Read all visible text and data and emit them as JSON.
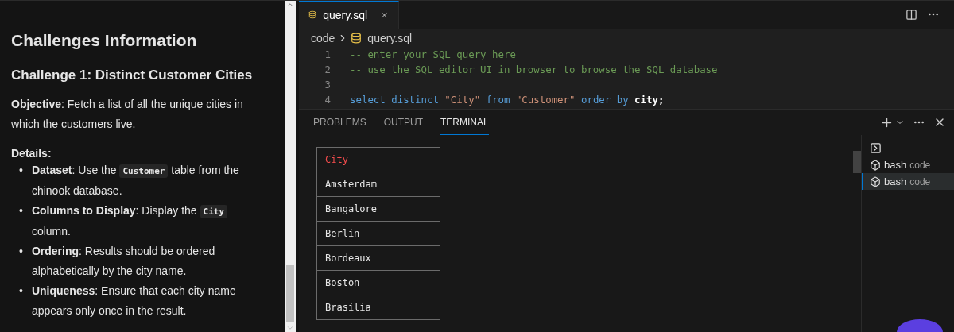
{
  "info": {
    "title": "Challenges Information",
    "challenge": "Challenge 1: Distinct Customer Cities",
    "objective": "**Objective**: Fetch a list of all the unique cities in which the customers live.",
    "details_label": "Details:",
    "details": [
      {
        "marker": "•",
        "segments": [
          {
            "kind": "bold",
            "text": "Dataset"
          },
          {
            "kind": "text",
            "text": ": Use the "
          },
          {
            "kind": "code",
            "text": "Customer"
          },
          {
            "kind": "text",
            "text": " table from the chinook database."
          }
        ]
      },
      {
        "marker": "•",
        "segments": [
          {
            "kind": "bold",
            "text": "Columns to Display"
          },
          {
            "kind": "text",
            "text": ": Display the "
          },
          {
            "kind": "code",
            "text": "City"
          },
          {
            "kind": "text",
            "text": " column."
          }
        ]
      },
      {
        "marker": "•",
        "segments": [
          {
            "kind": "bold",
            "text": "Ordering"
          },
          {
            "kind": "text",
            "text": ": Results should be ordered alphabetically by the city name."
          }
        ]
      },
      {
        "marker": "•",
        "segments": [
          {
            "kind": "bold",
            "text": "Uniqueness"
          },
          {
            "kind": "text",
            "text": ": Ensure that each city name appears only once in the result."
          }
        ]
      }
    ]
  },
  "editor": {
    "tabs": [
      {
        "label": "query.sql",
        "selected": true
      }
    ],
    "breadcrumb": [
      "code",
      "query.sql"
    ],
    "lines": [
      {
        "number": "1",
        "tokens": [
          {
            "kind": "comment",
            "text": "-- enter your SQL query here"
          }
        ]
      },
      {
        "number": "2",
        "tokens": [
          {
            "kind": "comment",
            "text": "-- use the SQL editor UI in browser to browse the SQL database"
          }
        ]
      },
      {
        "number": "3"
      },
      {
        "number": "4",
        "tokens": [
          {
            "kind": "keyword",
            "text": "select distinct "
          },
          {
            "kind": "string",
            "text": "\"City\""
          },
          {
            "kind": "keyword",
            "text": " from "
          },
          {
            "kind": "string",
            "text": "\"Customer\""
          },
          {
            "kind": "keyword",
            "text": " order by "
          },
          {
            "kind": "ident",
            "text": "city;"
          }
        ]
      }
    ]
  },
  "panel": {
    "tabs": [
      {
        "label": "PROBLEMS",
        "selected": false
      },
      {
        "label": "OUTPUT",
        "selected": false
      },
      {
        "label": "TERMINAL",
        "selected": true
      }
    ],
    "result": {
      "column": "City",
      "rows": [
        "Amsterdam",
        "Bangalore",
        "Berlin",
        "Bordeaux",
        "Boston",
        "Brasília"
      ]
    },
    "terminals": [
      {
        "name": "bash",
        "folder": "code",
        "selected": false
      },
      {
        "name": "bash",
        "folder": "code",
        "selected": true
      }
    ]
  }
}
